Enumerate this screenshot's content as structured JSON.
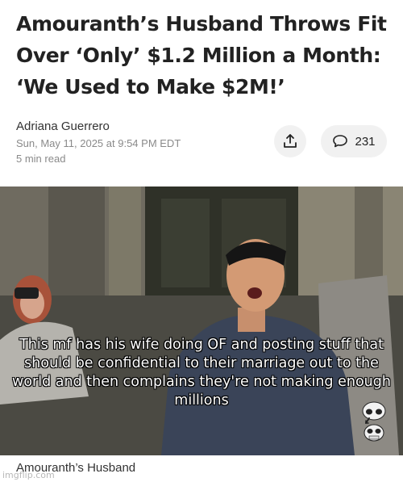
{
  "article": {
    "headline": "Amouranth’s Husband Throws Fit Over ‘Only’ $1.2 Million a Month: ‘We Used to Make $2M!’",
    "author": "Adriana Guerrero",
    "date": "Sun, May 11, 2025 at 9:54 PM EDT",
    "read_time": "5 min read",
    "share_icon": "share-upload-icon",
    "comment_icon": "speech-bubble-icon",
    "comment_count": "231"
  },
  "image": {
    "meme_caption": "This mf has his wife doing OF and posting stuff that should be confidential to their marriage out to the world and then complains they're not making enough millions",
    "emoji": "skull-emoji",
    "photo_caption": "Amouranth’s Husband",
    "watermark": "imgflip.com"
  }
}
